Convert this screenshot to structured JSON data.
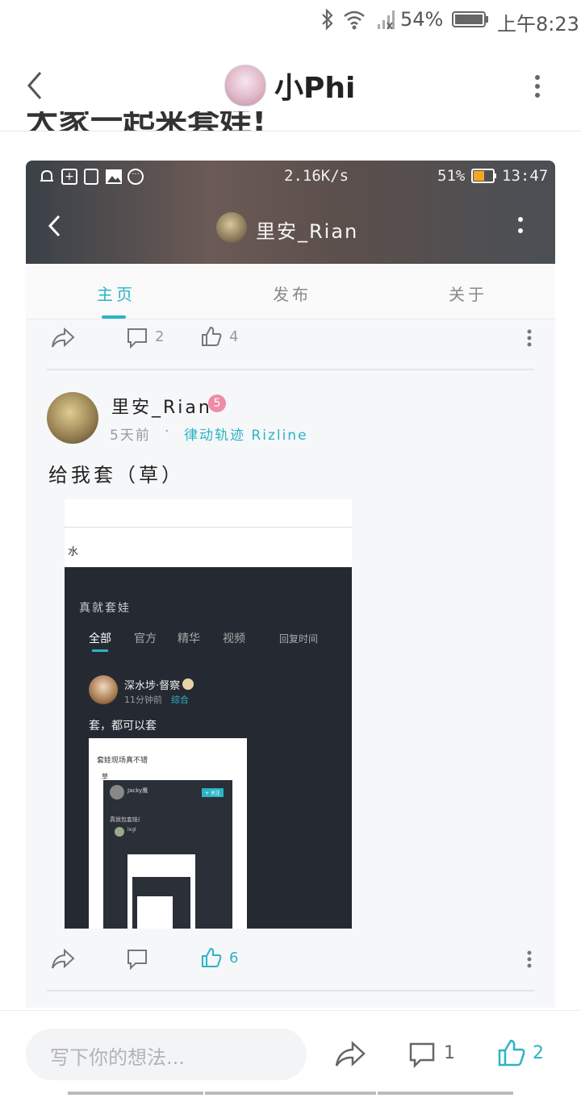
{
  "status_bar": {
    "battery": "54%",
    "time": "上午8:23"
  },
  "header": {
    "title": "小Phi"
  },
  "cutoff_text": "大家一起来套娃!",
  "embedded": {
    "status": {
      "speed": "2.16K/s",
      "battery": "51%",
      "time": "13:47"
    },
    "profile_name": "里安_Rian",
    "tabs": [
      "主页",
      "发布",
      "关于"
    ],
    "prev_post": {
      "comments": "2",
      "likes": "4"
    },
    "post": {
      "author": "里安_Rian",
      "badge": "5",
      "time": "5天前",
      "dot": "·",
      "category": "律动轨迹 Rizline",
      "text": "给我套（草）",
      "likes": "6",
      "nested": {
        "top_partial": "水",
        "section_title": "真就套娃",
        "filters": [
          "全部",
          "官方",
          "精华",
          "视频"
        ],
        "sort": "回复时间",
        "inner_author": "深水埗·督察",
        "inner_time": "11分钟前",
        "inner_category": "综合",
        "inner_text": "套，都可以套",
        "card_title": "套娃现场真不错",
        "card_sub": "草",
        "card_user": "Jacky鹰",
        "card_follow": "+ 关注",
        "card_line": "真就包套娃(",
        "card_user2": "lxgl"
      }
    }
  },
  "bottom": {
    "placeholder": "写下你的想法...",
    "comments": "1",
    "likes": "2"
  },
  "colors": {
    "accent": "#2bb4c6"
  }
}
